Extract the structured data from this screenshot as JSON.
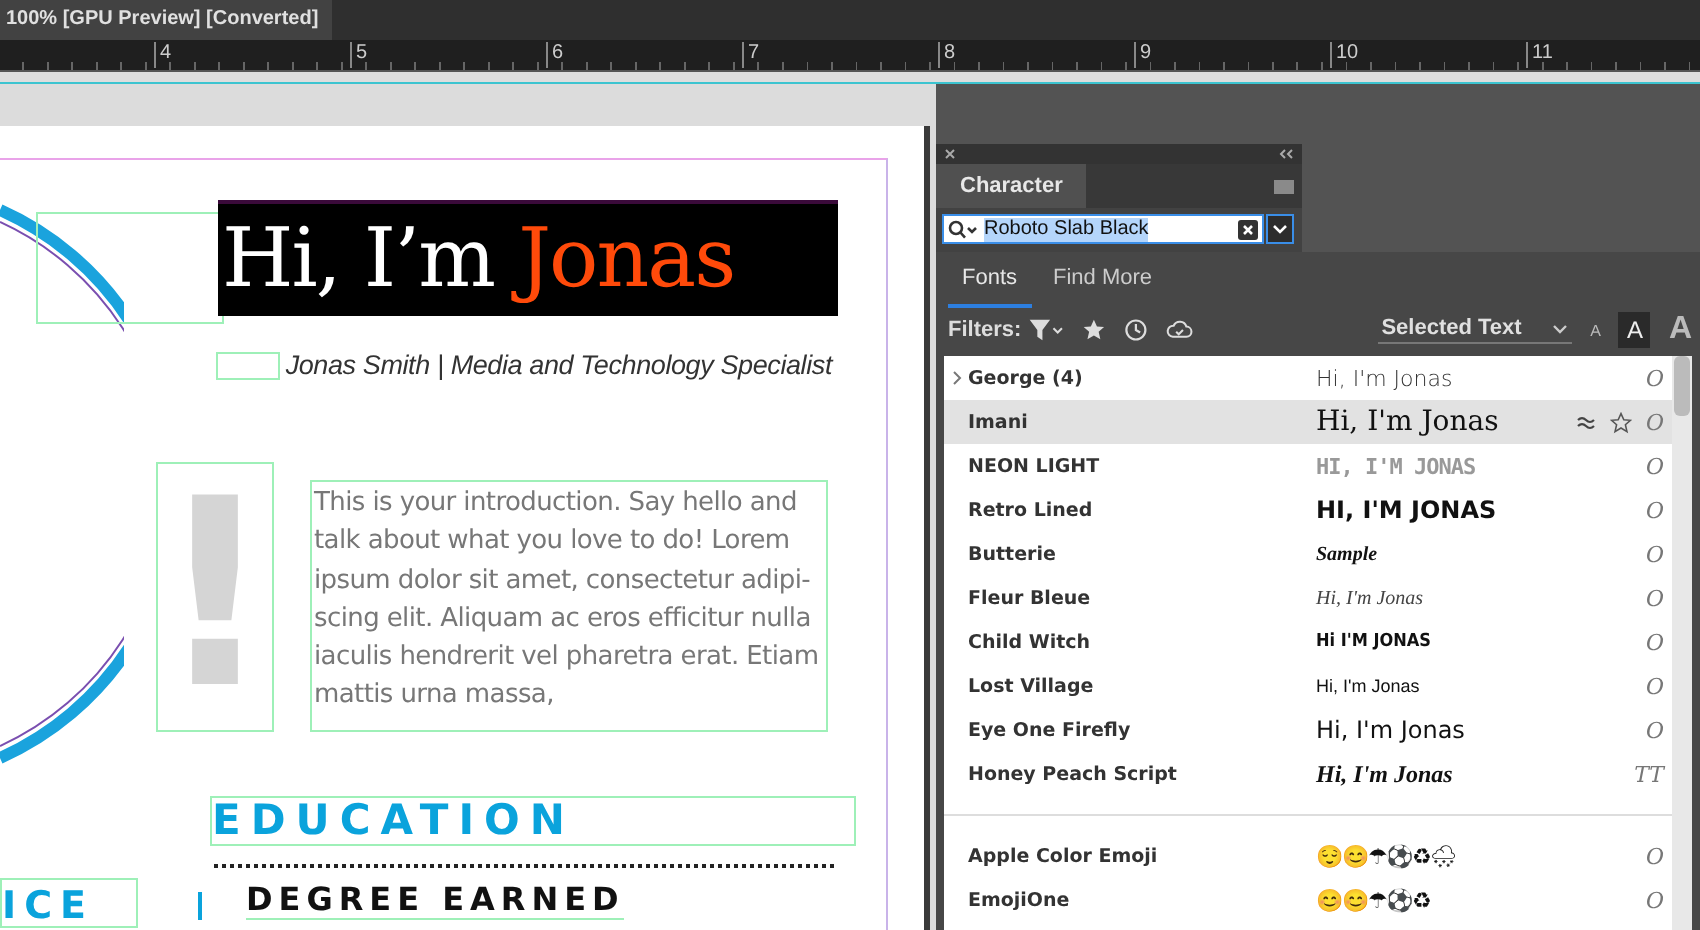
{
  "document_tab": {
    "title": "100% [GPU Preview] [Converted]"
  },
  "ruler": {
    "labels": [
      "4",
      "5",
      "6",
      "7",
      "8",
      "9",
      "10",
      "11"
    ]
  },
  "page": {
    "heading": {
      "greeting": "Hi, I’m",
      "name": "Jonas"
    },
    "subtitle": "Jonas Smith | Media and Technology Specialist",
    "intro": "This is your introduction. Say hello and talk about what you love to do! Lorem ipsum dolor sit amet, consectetur adipi-scing elit. Aliquam ac eros efficitur nulla iaculis hendrerit vel pharetra erat. Etiam mattis urna massa,",
    "mark": "!",
    "section_title": "EDUCATION",
    "side_title": "ICE",
    "item_title": "DEGREE EARNED"
  },
  "panel": {
    "title": "Character",
    "search": {
      "value": "Roboto Slab Black"
    },
    "tabs": [
      {
        "label": "Fonts",
        "selected": true
      },
      {
        "label": "Find More",
        "selected": false
      }
    ],
    "filters_label": "Filters:",
    "preview_source": "Selected Text",
    "sizes": [
      {
        "label": "A",
        "selected": false
      },
      {
        "label": "A",
        "selected": true
      },
      {
        "label": "A",
        "selected": false
      }
    ],
    "fonts": [
      {
        "kind": "family",
        "name": "George (4)",
        "sample": "Hi, I'm Jonas",
        "type_mark": "O",
        "selected": false
      },
      {
        "kind": "font",
        "name": "Imani",
        "sample": "Hi, I'm Jonas",
        "type_mark": "O",
        "selected": true
      },
      {
        "kind": "font",
        "name": "NEON LIGHT",
        "sample": "HI, I'M JONAS",
        "type_mark": "O",
        "selected": false
      },
      {
        "kind": "font",
        "name": "Retro Lined",
        "sample": "HI, I'M JONAS",
        "type_mark": "O",
        "selected": false
      },
      {
        "kind": "font",
        "name": "Butterie",
        "sample": "Sample",
        "type_mark": "O",
        "selected": false
      },
      {
        "kind": "font",
        "name": "Fleur Bleue",
        "sample": "Hi, I'm Jonas",
        "type_mark": "O",
        "selected": false
      },
      {
        "kind": "font",
        "name": "Child Witch",
        "sample": "Hi I'M JONAS",
        "type_mark": "O",
        "selected": false
      },
      {
        "kind": "font",
        "name": "Lost Village",
        "sample": "Hi, I'm Jonas",
        "type_mark": "O",
        "selected": false
      },
      {
        "kind": "font",
        "name": "Eye One Firefly",
        "sample": "Hi, I'm Jonas",
        "type_mark": "O",
        "selected": false
      },
      {
        "kind": "font",
        "name": "Honey Peach Script",
        "sample": "Hi, I'm Jonas",
        "type_mark": "TT",
        "selected": false
      }
    ],
    "emoji_fonts": [
      {
        "name": "Apple Color Emoji",
        "sample": "😌😊☂⚽♻🌨",
        "type_mark": "O",
        "selected": false
      },
      {
        "name": "EmojiOne",
        "sample": "😊😊☂⚽♻",
        "type_mark": "O",
        "selected": false
      }
    ]
  }
}
